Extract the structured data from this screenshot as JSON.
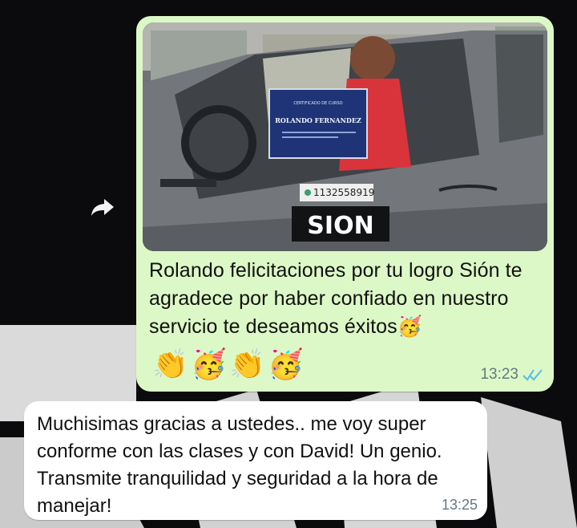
{
  "chat": {
    "messages": [
      {
        "direction": "outgoing",
        "text": "Rolando felicitaciones por tu logro Sión te agradece por haber confiado en nuestro servicio te deseamos éxitos🥳",
        "emoji_line": [
          "👏",
          "🥳",
          "👏",
          "🥳"
        ],
        "time": "13:23",
        "status": "read",
        "photo": {
          "phone": "1132558919",
          "brand": "SION",
          "certificate": {
            "heading": "CERTIFICADO DE CURSO",
            "recipient": "ROLANDO FERNANDEZ"
          }
        }
      },
      {
        "direction": "incoming",
        "text": "Muchisimas gracias a ustedes.. me voy super conforme con las clases y con David! Un genio. Transmite tranquilidad y seguridad a la hora de manejar!",
        "time": "13:25"
      }
    ]
  },
  "icons": {
    "forward": "forward-arrow-icon",
    "read_ticks": "double-check-icon"
  },
  "colors": {
    "outgoing_bubble": "#dcf8c6",
    "incoming_bubble": "#ffffff",
    "read_tick": "#53bdeb",
    "background": "#0b0b0d"
  }
}
